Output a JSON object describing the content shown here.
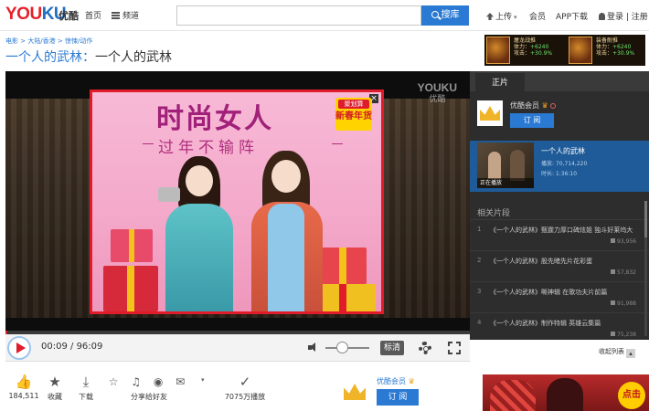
{
  "header": {
    "logo_a": "YOU",
    "logo_b": "KU",
    "logo_cn": "优酷",
    "nav_home": "首页",
    "nav_channels": "频道",
    "search_placeholder": "",
    "search_button": "搜库",
    "upload": "上传",
    "vip": "会员",
    "app": "APP下载",
    "login": "登录 | 注册"
  },
  "breadcrumb": "电影 > 大陆/香港 > 惊悚/动作",
  "title": {
    "main": "一个人的武林",
    "rest": "一个人的武林"
  },
  "ad_top": {
    "a_title": "屠龙战推",
    "a_l1": "体力：",
    "a_l2": "攻击：",
    "a_v1": "+6240",
    "a_v2": "+30.9%",
    "b_title": "装备耐推",
    "b_l1": "体力：",
    "b_l2": "攻击：",
    "b_v1": "+6240",
    "b_v2": "+30.9%"
  },
  "player": {
    "watermark_a": "YOUKU",
    "watermark_b": "优酷",
    "current_time": "00:09",
    "total_time": "96:09",
    "time_sep": " / ",
    "progress": 0.002,
    "quality": "标清"
  },
  "ad_popup": {
    "main_text": "时尚女人",
    "sub_text": "过年不输阵",
    "tag_top": "聚划算",
    "tag_main": "新春年货",
    "close": "×"
  },
  "actions": {
    "like_count": "184,511",
    "fav": "收藏",
    "download": "下载",
    "share": "分享给好友",
    "plays": "7075万播放"
  },
  "channel": {
    "name": "优酷会员",
    "subscribe": "订 阅"
  },
  "right_panel": {
    "tab": "正片",
    "channel_name": "优酷会员",
    "subscribe": "订 阅",
    "now_title": "一个人的武林",
    "now_plays": "播放: 70,714,220",
    "now_duration": "时长: 1:36:10",
    "now_label": "正在播放",
    "related_heading": "相关片段",
    "related": [
      {
        "n": "1",
        "title": "《一个人的武林》甄霆力厚口碑炫姐 独斗好莱坞大",
        "count": "93,956"
      },
      {
        "n": "2",
        "title": "《一个人的武林》股先睹先片花彩蛋",
        "count": "57,832"
      },
      {
        "n": "3",
        "title": "《一个人的武林》嘶神辑 在歌功夫片前篇",
        "count": "91,988"
      },
      {
        "n": "4",
        "title": "《一个人的武林》制作特辑 英雄云集篇",
        "count": "75,238"
      }
    ],
    "more": "收起列表"
  },
  "ad_bottom": {
    "badge": "点击"
  },
  "colors": {
    "accent": "#2a7ad3",
    "red": "#e01b2a",
    "panel": "#2d2d2d"
  }
}
